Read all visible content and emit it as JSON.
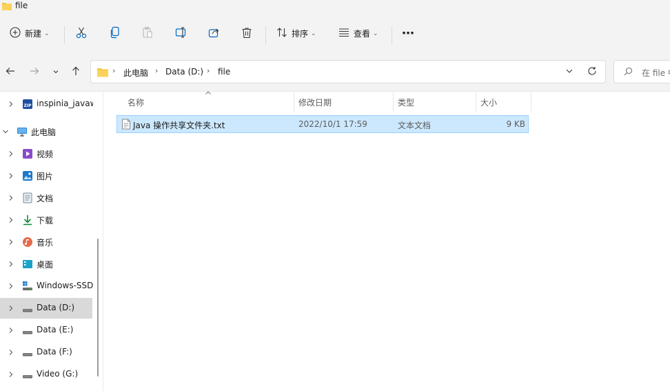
{
  "window": {
    "title": "file"
  },
  "toolbar": {
    "new_label": "新建",
    "sort_label": "排序",
    "view_label": "查看",
    "more_label": "⋯"
  },
  "address": {
    "crumbs": [
      "此电脑",
      "Data (D:)",
      "file"
    ],
    "search_placeholder": "在 file 中"
  },
  "sidebar": {
    "items": [
      {
        "label": "inspinia_javaw",
        "icon": "zip-icon"
      },
      {
        "label": "此电脑",
        "icon": "computer-icon"
      },
      {
        "label": "视频",
        "icon": "video-icon"
      },
      {
        "label": "图片",
        "icon": "pictures-icon"
      },
      {
        "label": "文档",
        "icon": "documents-icon"
      },
      {
        "label": "下载",
        "icon": "download-icon"
      },
      {
        "label": "音乐",
        "icon": "music-icon"
      },
      {
        "label": "桌面",
        "icon": "desktop-icon"
      },
      {
        "label": "Windows-SSD",
        "icon": "windows-drive-icon"
      },
      {
        "label": "Data (D:)",
        "icon": "drive-icon"
      },
      {
        "label": "Data (E:)",
        "icon": "drive-icon"
      },
      {
        "label": "Data (F:)",
        "icon": "drive-icon"
      },
      {
        "label": "Video (G:)",
        "icon": "drive-icon"
      }
    ],
    "selected": "Data (D:)"
  },
  "filelist": {
    "columns": [
      "名称",
      "修改日期",
      "类型",
      "大小"
    ],
    "rows": [
      {
        "name": "Java 操作共享文件夹.txt",
        "modified": "2022/10/1 17:59",
        "type": "文本文档",
        "size": "9 KB"
      }
    ]
  },
  "colors": {
    "selection": "#cce8ff",
    "selection_border": "#99d1ff",
    "folder": "#f8c740",
    "accent": "#0067c0"
  }
}
